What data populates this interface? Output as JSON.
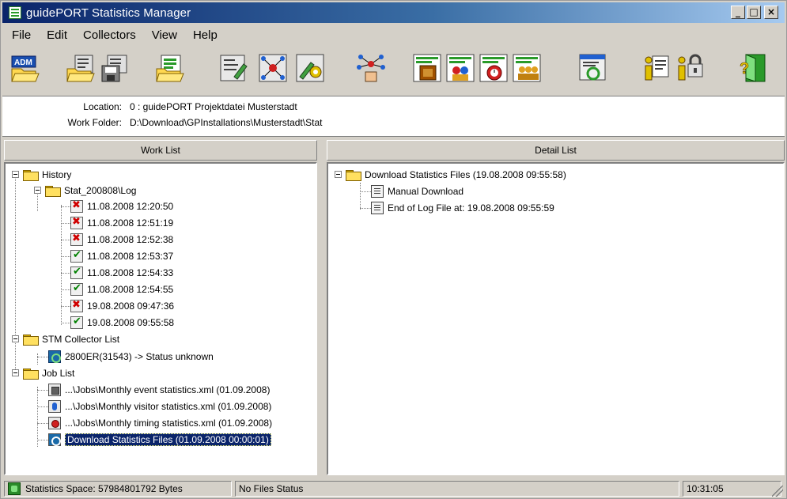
{
  "window": {
    "title": "guidePORT Statistics Manager",
    "controls": {
      "minimize": "_",
      "maximize": "□",
      "close": "×"
    }
  },
  "menu": {
    "items": [
      "File",
      "Edit",
      "Collectors",
      "View",
      "Help"
    ]
  },
  "toolbar": {
    "buttons": [
      "adm-open-icon",
      "open-folder-icon",
      "save-icon",
      "open-list-icon",
      "edit-collector-icon",
      "network-collector-icon",
      "collector-settings-icon",
      "network-hand-icon",
      "event-stats-icon",
      "visitor-stats-icon",
      "timing-stats-icon",
      "group-stats-icon",
      "refresh-files-icon",
      "info-icon",
      "info-lock-icon",
      "exit-icon"
    ]
  },
  "info": {
    "location_label": "Location:",
    "location_value": "0 : guidePORT Projektdatei Musterstadt",
    "workfolder_label": "Work Folder:",
    "workfolder_value": "D:\\Download\\GPInstallations\\Musterstadt\\Stat"
  },
  "worklist": {
    "header": "Work List",
    "history_label": "History",
    "stat_folder_label": "Stat_200808\\Log",
    "logs": [
      {
        "label": "11.08.2008 12:20:50",
        "status": "error"
      },
      {
        "label": "11.08.2008 12:51:19",
        "status": "error"
      },
      {
        "label": "11.08.2008 12:52:38",
        "status": "error"
      },
      {
        "label": "11.08.2008 12:53:37",
        "status": "ok"
      },
      {
        "label": "11.08.2008 12:54:33",
        "status": "ok"
      },
      {
        "label": "11.08.2008 12:54:55",
        "status": "ok"
      },
      {
        "label": "19.08.2008 09:47:36",
        "status": "error"
      },
      {
        "label": "19.08.2008 09:55:58",
        "status": "ok"
      }
    ],
    "collector_list_label": "STM Collector List",
    "collector_item": "2800ER(31543) -> Status unknown",
    "job_list_label": "Job List",
    "jobs": [
      "...\\Jobs\\Monthly event statistics.xml (01.09.2008)",
      "...\\Jobs\\Monthly visitor statistics.xml (01.09.2008)",
      "...\\Jobs\\Monthly timing statistics.xml (01.09.2008)",
      "Download Statistics Files (01.09.2008 00:00:01)"
    ]
  },
  "detaillist": {
    "header": "Detail List",
    "root_label": "Download Statistics Files (19.08.2008 09:55:58)",
    "items": [
      "Manual Download",
      "End of Log File at: 19.08.2008 09:55:59"
    ]
  },
  "status": {
    "space": "Statistics Space: 57984801792 Bytes",
    "files": "No Files Status",
    "time": "10:31:05"
  },
  "colors": {
    "title_start": "#0a246a",
    "title_end": "#a6caf0",
    "selection": "#0a246a",
    "chrome": "#d4d0c8"
  }
}
